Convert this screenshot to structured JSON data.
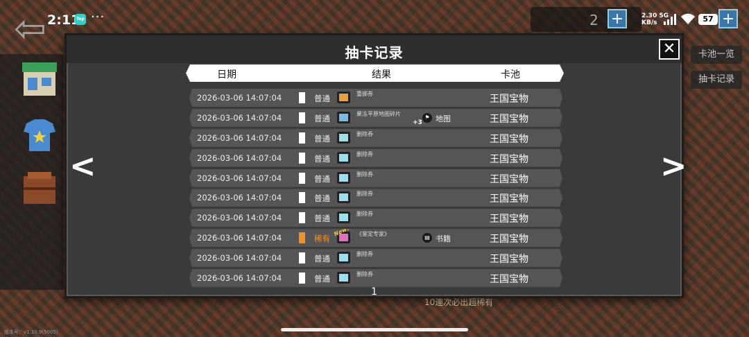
{
  "status_bar": {
    "time": "2:11",
    "app_badge": "Top",
    "more": "···",
    "net_speed_value": "2.30",
    "net_speed_network": "5G",
    "net_speed_unit": "KB/s",
    "battery": "57"
  },
  "background": {
    "currency_count": "2",
    "plus_label": "+",
    "back_arrow": "⇦",
    "right_tabs": [
      "卡池一览",
      "抽卡记录"
    ],
    "footer_text": "10連次必出超稀有",
    "version": "版本号：v1.10.9(5005)"
  },
  "modal": {
    "title": "抽卡记录",
    "close_label": "✕",
    "columns": {
      "date": "日期",
      "result": "结果",
      "pool": "卡池"
    },
    "prev_arrow": "<",
    "next_arrow": ">",
    "page": "1",
    "rows": [
      {
        "date": "2026-03-06 14:07:04",
        "rarity": "普通",
        "rarity_color": "#ffffff",
        "item": "重掷券",
        "icon_color": "#e8a040",
        "new": "",
        "plus": "",
        "category_icon": "",
        "category": "",
        "pool": "王国宝物"
      },
      {
        "date": "2026-03-06 14:07:04",
        "rarity": "普通",
        "rarity_color": "#ffffff",
        "item": "果冻平原地图碎片",
        "icon_color": "#7db8e0",
        "new": "",
        "plus": "+3",
        "category_icon": "⚑",
        "category": "地图",
        "pool": "王国宝物"
      },
      {
        "date": "2026-03-06 14:07:04",
        "rarity": "普通",
        "rarity_color": "#ffffff",
        "item": "删除券",
        "icon_color": "#9ce0f0",
        "new": "",
        "plus": "",
        "category_icon": "",
        "category": "",
        "pool": "王国宝物"
      },
      {
        "date": "2026-03-06 14:07:04",
        "rarity": "普通",
        "rarity_color": "#ffffff",
        "item": "删除券",
        "icon_color": "#9ce0f0",
        "new": "",
        "plus": "",
        "category_icon": "",
        "category": "",
        "pool": "王国宝物"
      },
      {
        "date": "2026-03-06 14:07:04",
        "rarity": "普通",
        "rarity_color": "#ffffff",
        "item": "删除券",
        "icon_color": "#9ce0f0",
        "new": "",
        "plus": "",
        "category_icon": "",
        "category": "",
        "pool": "王国宝物"
      },
      {
        "date": "2026-03-06 14:07:04",
        "rarity": "普通",
        "rarity_color": "#ffffff",
        "item": "删除券",
        "icon_color": "#9ce0f0",
        "new": "",
        "plus": "",
        "category_icon": "",
        "category": "",
        "pool": "王国宝物"
      },
      {
        "date": "2026-03-06 14:07:04",
        "rarity": "普通",
        "rarity_color": "#ffffff",
        "item": "删除券",
        "icon_color": "#9ce0f0",
        "new": "",
        "plus": "",
        "category_icon": "",
        "category": "",
        "pool": "王国宝物"
      },
      {
        "date": "2026-03-06 14:07:04",
        "rarity": "稀有",
        "rarity_color": "#f0902a",
        "item": "《鉴定专家》",
        "icon_color": "#e070c0",
        "new": "New!",
        "plus": "",
        "category_icon": "▤",
        "category": "书籍",
        "pool": "王国宝物"
      },
      {
        "date": "2026-03-06 14:07:04",
        "rarity": "普通",
        "rarity_color": "#ffffff",
        "item": "删除券",
        "icon_color": "#9ce0f0",
        "new": "",
        "plus": "",
        "category_icon": "",
        "category": "",
        "pool": "王国宝物"
      },
      {
        "date": "2026-03-06 14:07:04",
        "rarity": "普通",
        "rarity_color": "#ffffff",
        "item": "删除券",
        "icon_color": "#9ce0f0",
        "new": "",
        "plus": "",
        "category_icon": "",
        "category": "",
        "pool": "王国宝物"
      }
    ]
  }
}
